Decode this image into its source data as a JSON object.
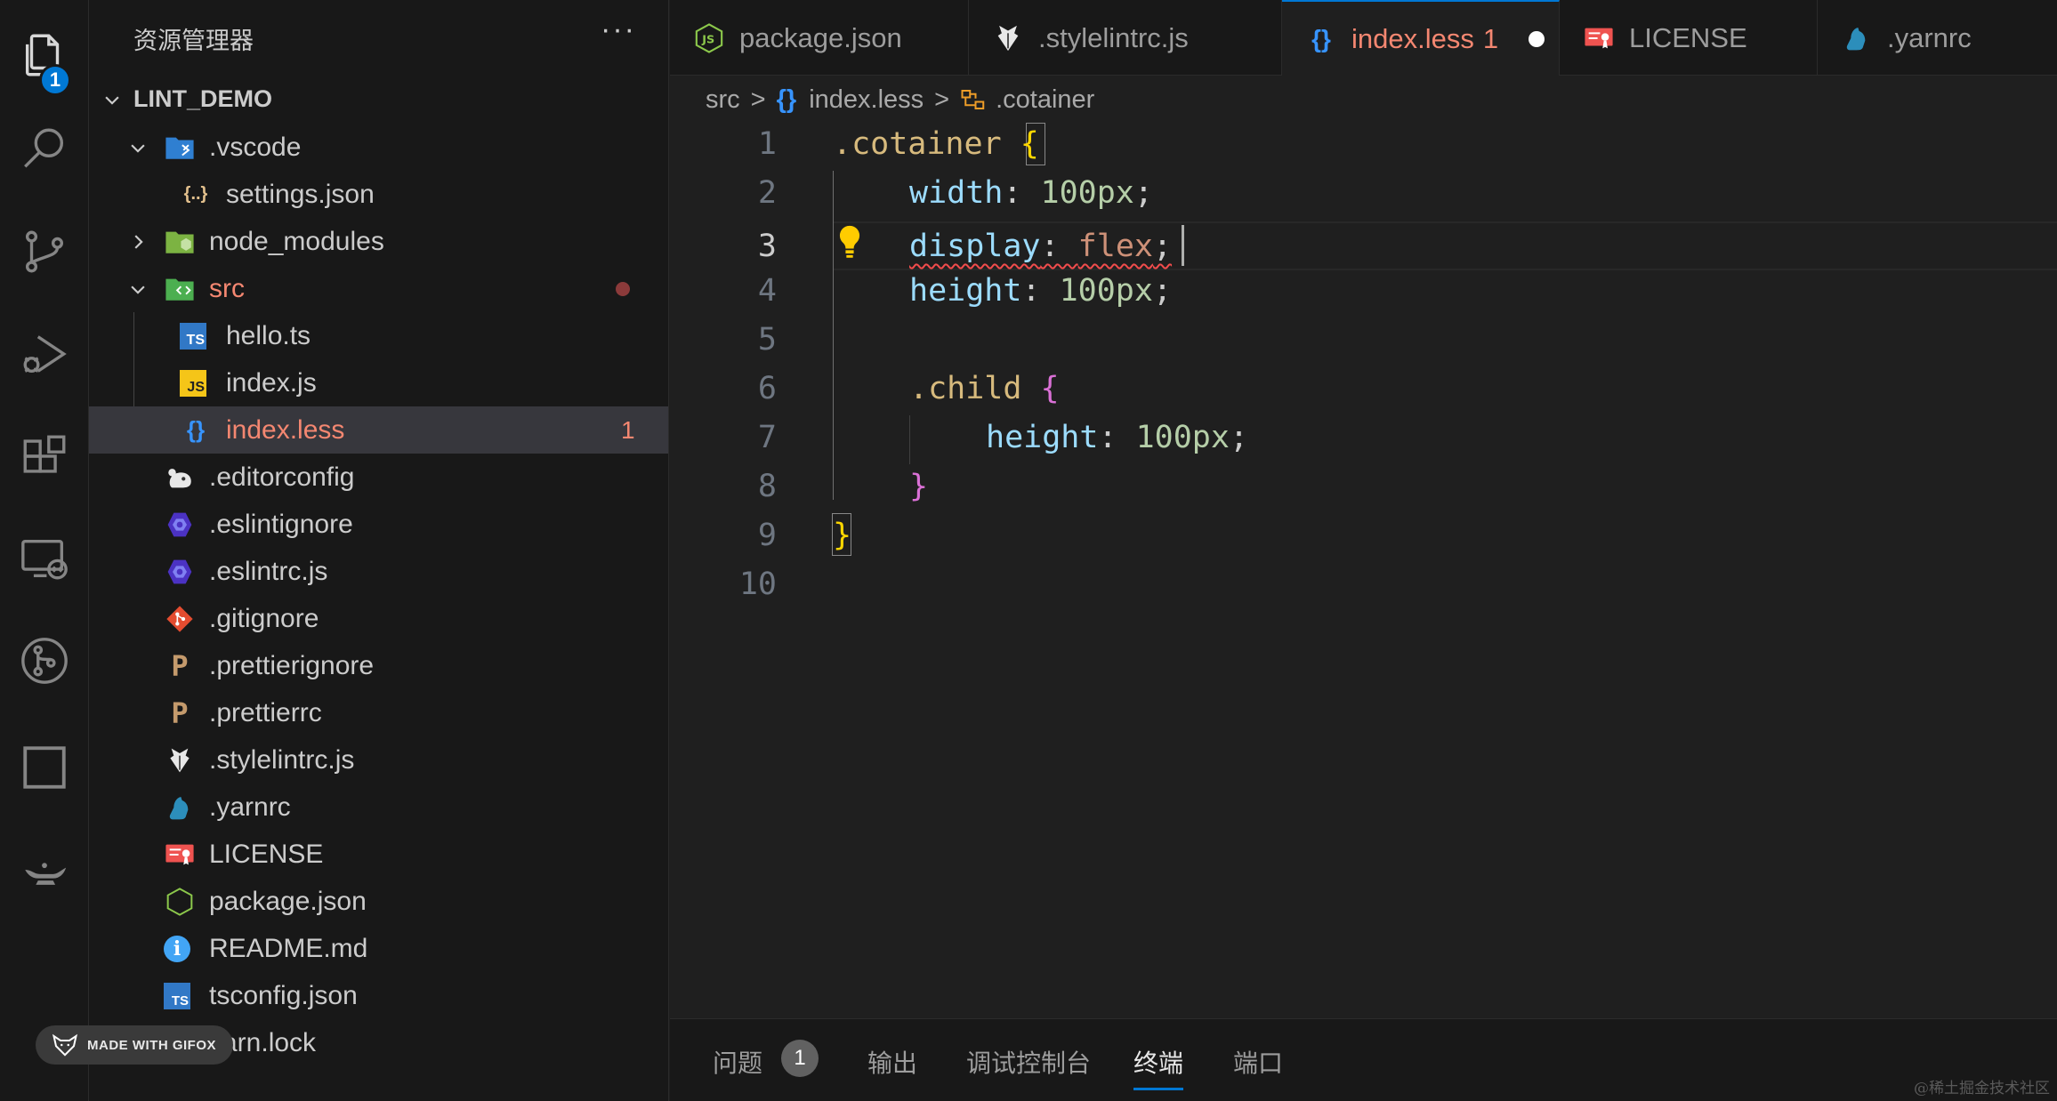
{
  "activity_bar": {
    "explorer_badge": "1",
    "icons": [
      "files-icon",
      "search-icon",
      "source-control-icon",
      "run-debug-icon",
      "extensions-icon",
      "remote-explorer-icon",
      "git-graph-icon",
      "square-icon",
      "genie-lamp-icon"
    ]
  },
  "sidebar": {
    "title": "资源管理器",
    "more": "···",
    "project": "LINT_DEMO",
    "items": [
      {
        "label": "LINT_DEMO"
      },
      {
        "label": ".vscode"
      },
      {
        "label": "settings.json",
        "icon_text": "{..}"
      },
      {
        "label": "node_modules"
      },
      {
        "label": "src"
      },
      {
        "label": "hello.ts",
        "icon_text": "TS"
      },
      {
        "label": "index.js",
        "icon_text": "JS"
      },
      {
        "label": "index.less",
        "icon_text": "{}",
        "problems": "1"
      },
      {
        "label": ".editorconfig"
      },
      {
        "label": ".eslintignore"
      },
      {
        "label": ".eslintrc.js"
      },
      {
        "label": ".gitignore"
      },
      {
        "label": ".prettierignore",
        "icon_text": "P"
      },
      {
        "label": ".prettierrc",
        "icon_text": "P"
      },
      {
        "label": ".stylelintrc.js"
      },
      {
        "label": ".yarnrc"
      },
      {
        "label": "LICENSE"
      },
      {
        "label": "package.json",
        "icon_text": "JS"
      },
      {
        "label": "README.md",
        "icon_text": "i"
      },
      {
        "label": "tsconfig.json",
        "icon_text": "TS"
      },
      {
        "label": "yarn.lock"
      }
    ]
  },
  "gifox_badge": "MADE WITH GIFOX",
  "tabs": [
    {
      "label": "package.json",
      "icon_text": "JS"
    },
    {
      "label": ".stylelintrc.js"
    },
    {
      "label": "index.less",
      "icon_text": "{}",
      "badge": "1",
      "active": true,
      "dirty": true
    },
    {
      "label": "LICENSE"
    },
    {
      "label": ".yarnrc"
    }
  ],
  "breadcrumb": {
    "folder": "src",
    "file": "index.less",
    "file_icon": "{}",
    "symbol": ".cotainer",
    "separator": ">"
  },
  "editor": {
    "current_line": 3,
    "line_numbers": [
      "1",
      "2",
      "3",
      "4",
      "5",
      "6",
      "7",
      "8",
      "9",
      "10"
    ],
    "tokens": {
      "l1_sel": ".cotainer",
      "l1_brace": "{",
      "l2_prop": "width",
      "l2_colon": ": ",
      "l2_val": "100px",
      "l2_semi": ";",
      "l3_prop": "display",
      "l3_colon": ": ",
      "l3_val": "flex",
      "l3_semi": ";",
      "l4_prop": "height",
      "l4_colon": ": ",
      "l4_val": "100px",
      "l4_semi": ";",
      "l6_sel": ".child",
      "l6_brace": "{",
      "l7_prop": "height",
      "l7_colon": ": ",
      "l7_val": "100px",
      "l7_semi": ";",
      "l8_brace": "}",
      "l9_brace": "}"
    }
  },
  "panel": {
    "tabs": [
      "问题",
      "输出",
      "调试控制台",
      "终端",
      "端口"
    ],
    "problems_count": "1",
    "active_tab": "终端"
  },
  "watermark": "@稀土掘金技术社区",
  "colors": {
    "accent": "#0078d4",
    "error": "#f48771",
    "brace_yellow": "#ffd700",
    "brace_purple": "#da70d6"
  }
}
